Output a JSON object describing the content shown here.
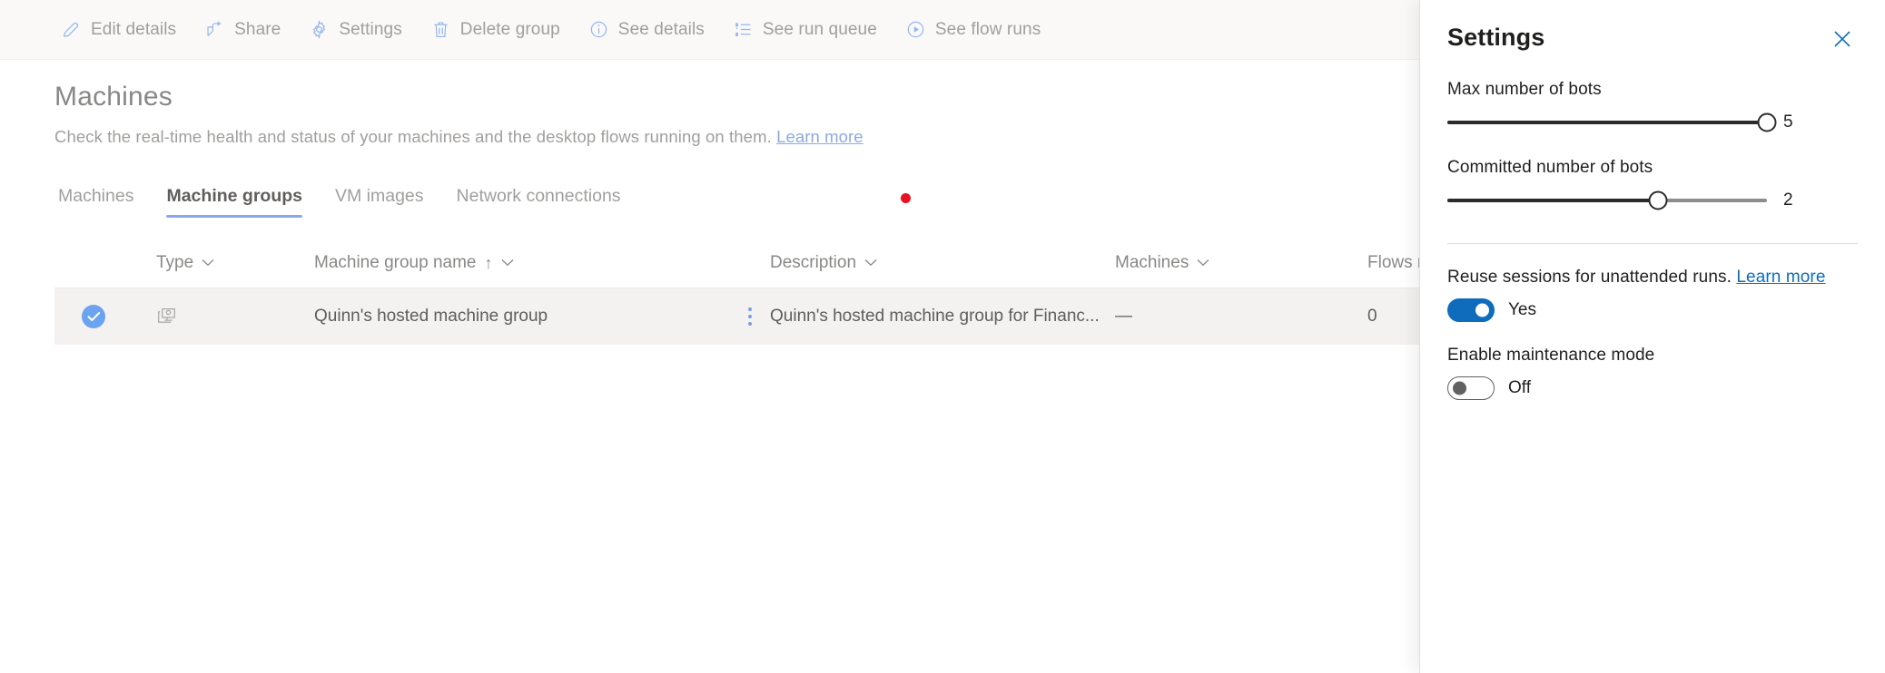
{
  "commandbar": {
    "items": [
      {
        "label": "Edit details",
        "icon": "pencil-icon"
      },
      {
        "label": "Share",
        "icon": "share-icon"
      },
      {
        "label": "Settings",
        "icon": "gear-icon"
      },
      {
        "label": "Delete group",
        "icon": "trash-icon"
      },
      {
        "label": "See details",
        "icon": "info-icon"
      },
      {
        "label": "See run queue",
        "icon": "list-icon"
      },
      {
        "label": "See flow runs",
        "icon": "play-circle-icon"
      }
    ]
  },
  "page": {
    "title": "Machines",
    "description": "Check the real-time health and status of your machines and the desktop flows running on them.",
    "description_link": "Learn more"
  },
  "tabs": {
    "items": [
      {
        "label": "Machines",
        "active": false
      },
      {
        "label": "Machine groups",
        "active": true
      },
      {
        "label": "VM images",
        "active": false
      },
      {
        "label": "Network connections",
        "active": false
      }
    ],
    "notification_dot_color": "#e81123"
  },
  "table": {
    "headers": {
      "type": "Type",
      "name": "Machine group name",
      "description": "Description",
      "machines": "Machines",
      "flows_running": "Flows ru"
    },
    "sort_indicator": "↑",
    "rows": [
      {
        "selected": true,
        "type_icon": "machine-group-icon",
        "name": "Quinn's hosted machine group",
        "description": "Quinn's hosted machine group for Financ...",
        "machines": "—",
        "flows_running": "0"
      }
    ]
  },
  "panel": {
    "title": "Settings",
    "close_icon": "close-icon",
    "max_bots": {
      "label": "Max number of bots",
      "value": "5",
      "percent": 100
    },
    "committed_bots": {
      "label": "Committed number of bots",
      "value": "2",
      "percent": 66
    },
    "reuse_sessions": {
      "label": "Reuse sessions for unattended runs.",
      "link": "Learn more",
      "state": "Yes",
      "on": true
    },
    "maintenance_mode": {
      "label": "Enable maintenance mode",
      "state": "Off",
      "on": false
    },
    "accent_color": "#0f6cbd"
  }
}
